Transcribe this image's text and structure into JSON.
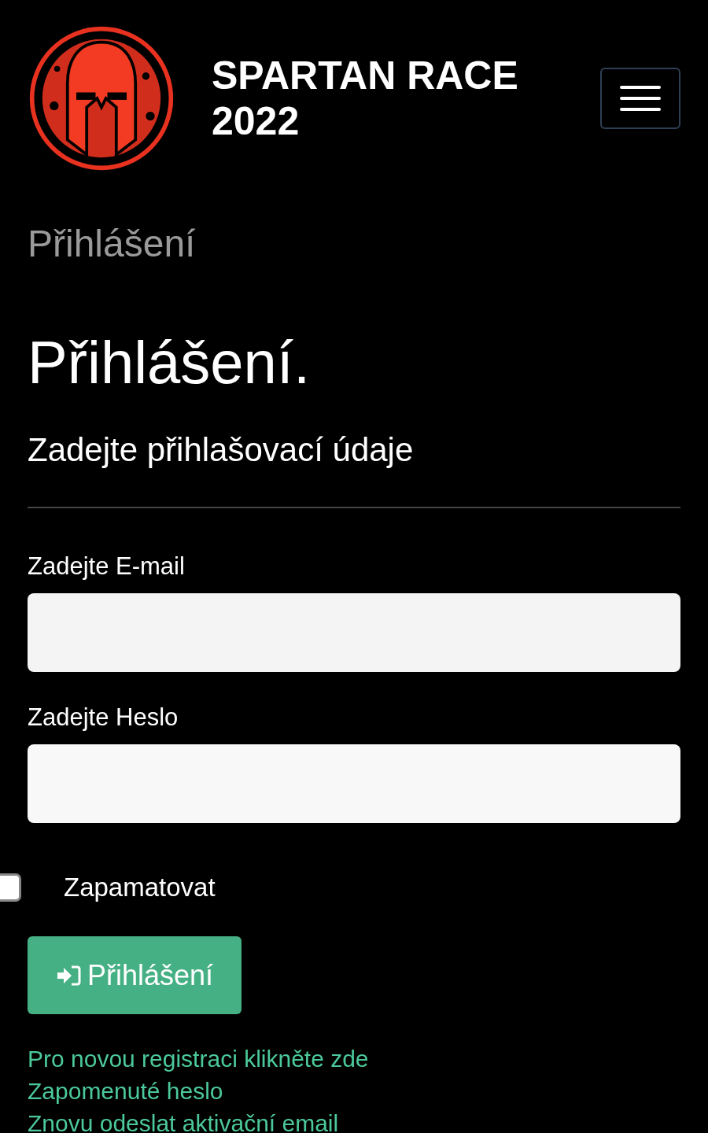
{
  "header": {
    "title_line_1": "SPARTAN RACE",
    "title_line_2": "2022"
  },
  "breadcrumb": "Přihlášení",
  "heading": "Přihlášení.",
  "subtitle": "Zadejte přihlašovací údaje",
  "form": {
    "email_label": "Zadejte E-mail",
    "password_label": "Zadejte Heslo",
    "remember": {
      "label": "Zapamatovat",
      "checked": false
    },
    "submit": "Přihlášení"
  },
  "links": [
    "Pro novou registraci klikněte zde",
    "Zapomenuté heslo",
    "Znovu odeslat aktivační email"
  ]
}
